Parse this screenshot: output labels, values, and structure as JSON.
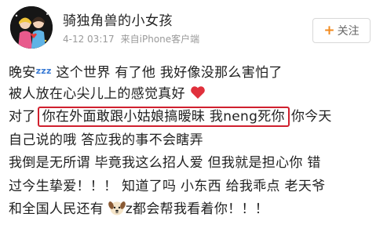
{
  "user": {
    "name": "骑独角兽的小女孩"
  },
  "meta": {
    "time": "4-12 03:17",
    "source": "来自iPhone客户端"
  },
  "follow_button": {
    "plus": "+",
    "label": "关注"
  },
  "post": {
    "line1_a": "晚安",
    "line1_zzz": "zzz",
    "line1_b": " 这个世界 有了他 我好像没那么害怕了",
    "line2": "被人放在心尖儿上的感觉真好",
    "line3_a": "对了",
    "line3_highlight": "你在外面敢跟小姑娘搞暧昧 我neng死你",
    "line3_b": "你今天",
    "line4": "自己说的哦 答应我的事不会瞎弄",
    "line5": "我倒是无所谓 毕竟我这么招人爱  但我就是担心你  错",
    "line6": "过今生挚爱！！！ 知道了吗 小东西 给我乖点 老天爷",
    "line7_a": "和全国人民还有",
    "line7_b": "z都会帮我看着你！！！"
  },
  "icons": {
    "zzz": "zzz-sleep-icon",
    "heart": "heart-emoji-icon",
    "dog": "dog-emoji-icon",
    "avatar": "user-avatar"
  },
  "colors": {
    "highlight_border": "#d0202e",
    "follow_plus": "#f28a1e",
    "meta_text": "#9a9a9a"
  }
}
